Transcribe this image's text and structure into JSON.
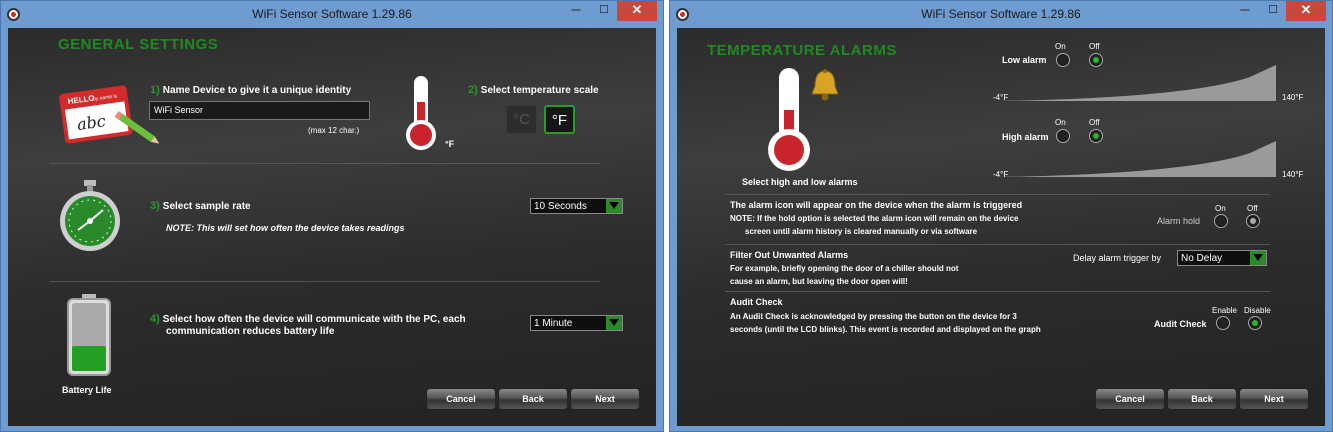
{
  "window1": {
    "title": "WiFi Sensor Software 1.29.86",
    "controls": {
      "minimize": "─",
      "maximize": "☐",
      "close": "✕"
    },
    "heading": "GENERAL SETTINGS",
    "step1": {
      "num": "1)",
      "label": "Name Device to give it a unique identity",
      "value": "WiFi Sensor",
      "hint": "(max 12 char.)"
    },
    "step2": {
      "num": "2)",
      "label": "Select temperature scale",
      "celsius": "°C",
      "fahrenheit": "°F",
      "selected": "fahrenheit"
    },
    "thermo_unit": "°F",
    "name_tag": {
      "top": "HELLO",
      "sub": "my name is",
      "text": "abc"
    },
    "step3": {
      "num": "3)",
      "label": "Select sample rate",
      "note": "NOTE: This will set how often the device takes readings",
      "value": "10 Seconds"
    },
    "step4": {
      "num": "4)",
      "label_line1": "Select how often the device will communicate with the PC, each",
      "label_line2": "communication reduces battery life",
      "value": "1 Minute"
    },
    "battery_label": "Battery Life",
    "buttons": {
      "cancel": "Cancel",
      "back": "Back",
      "next": "Next"
    }
  },
  "window2": {
    "title": "WiFi Sensor Software 1.29.86",
    "controls": {
      "minimize": "─",
      "maximize": "☐",
      "close": "✕"
    },
    "heading": "TEMPERATURE ALARMS",
    "low_alarm": {
      "label": "Low alarm",
      "on": "On",
      "off": "Off",
      "selected": "off",
      "min": "-4°F",
      "max": "140°F"
    },
    "high_alarm": {
      "label": "High alarm",
      "on": "On",
      "off": "Off",
      "selected": "off",
      "min": "-4°F",
      "max": "140°F"
    },
    "caption": "Select high and low alarms",
    "alarm_icon": {
      "line1": "The alarm icon will appear on the device when the alarm is triggered",
      "line2": "NOTE: If the hold option is selected the alarm icon will remain on the device",
      "line3": "screen until alarm history is cleared manually or via software",
      "hold_label": "Alarm hold",
      "on": "On",
      "off": "Off",
      "selected": "off"
    },
    "filter": {
      "title": "Filter Out Unwanted Alarms",
      "line1": "For example, briefly opening the door of a chiller should not",
      "line2": "cause an alarm, but leaving the door open will!",
      "delay_label": "Delay alarm trigger by",
      "value": "No Delay"
    },
    "audit": {
      "title": "Audit Check",
      "line1": "An Audit Check is acknowledged by pressing the button on the device for 3",
      "line2": "seconds (until the LCD blinks). This event is recorded and displayed on the graph",
      "label": "Audit Check",
      "enable": "Enable",
      "disable": "Disable",
      "selected": "disable"
    },
    "buttons": {
      "cancel": "Cancel",
      "back": "Back",
      "next": "Next"
    }
  },
  "colors": {
    "accent_green": "#2a9a2a",
    "heading_green": "#1f8a1f",
    "titlebar": "#6e9bd0",
    "close_red": "#c9483c"
  }
}
